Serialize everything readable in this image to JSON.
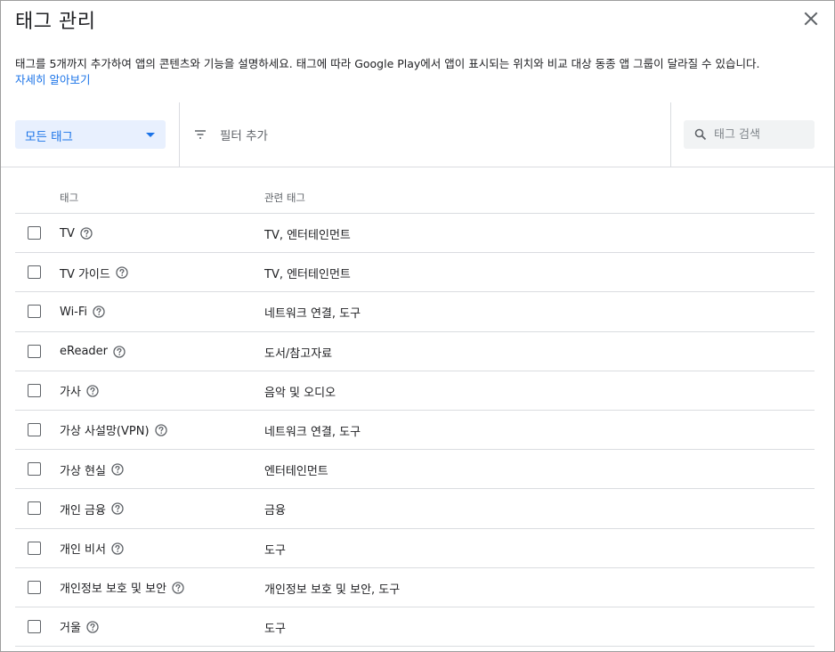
{
  "dialog": {
    "title": "태그 관리",
    "description": "태그를 5개까지 추가하여 앱의 콘텐츠와 기능을 설명하세요. 태그에 따라 Google Play에서 앱이 표시되는 위치와 비교 대상 동종 앱 그룹이 달라질 수 있습니다.",
    "learn_more": "자세히 알아보기"
  },
  "toolbar": {
    "select_value": "모든 태그",
    "filter_label": "필터 추가",
    "search_placeholder": "태그 검색"
  },
  "table": {
    "headers": {
      "tag": "태그",
      "related": "관련 태그"
    },
    "rows": [
      {
        "tag": "TV",
        "related": "TV, 엔터테인먼트",
        "checked": false
      },
      {
        "tag": "TV 가이드",
        "related": "TV, 엔터테인먼트",
        "checked": false
      },
      {
        "tag": "Wi-Fi",
        "related": "네트워크 연결, 도구",
        "checked": false
      },
      {
        "tag": "eReader",
        "related": "도서/참고자료",
        "checked": false
      },
      {
        "tag": "가사",
        "related": "음악 및 오디오",
        "checked": false
      },
      {
        "tag": "가상 사설망(VPN)",
        "related": "네트워크 연결, 도구",
        "checked": false
      },
      {
        "tag": "가상 현실",
        "related": "엔터테인먼트",
        "checked": false
      },
      {
        "tag": "개인 금융",
        "related": "금융",
        "checked": false
      },
      {
        "tag": "개인 비서",
        "related": "도구",
        "checked": false
      },
      {
        "tag": "개인정보 보호 및 보안",
        "related": "개인정보 보호 및 보안, 도구",
        "checked": false
      },
      {
        "tag": "거울",
        "related": "도구",
        "checked": false
      }
    ]
  },
  "colors": {
    "accent": "#1a73e8",
    "select_bg": "#e8f0fe",
    "divider": "#dadce0",
    "secondary_text": "#5f6368"
  },
  "icons": {
    "close": "close-icon",
    "filter": "filter-icon",
    "search": "search-icon",
    "help": "help-circle-icon",
    "dropdown": "caret-down-icon"
  }
}
